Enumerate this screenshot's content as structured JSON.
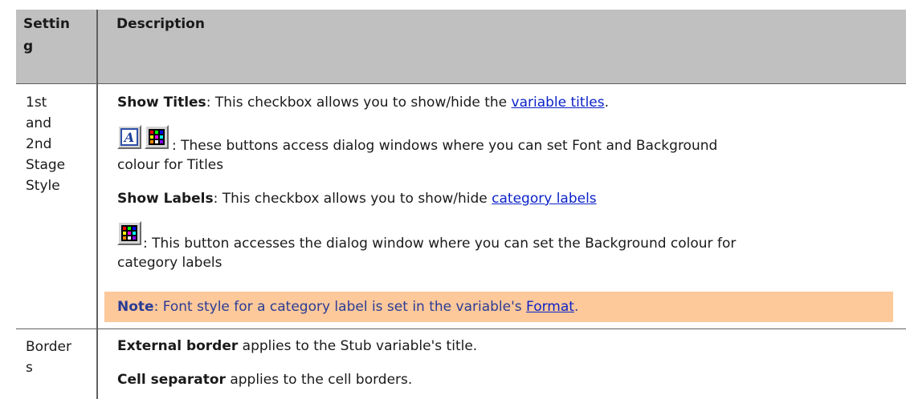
{
  "header": {
    "setting_line1": "Settin",
    "setting_line2": "g",
    "description": "Description"
  },
  "row1": {
    "setting_lines": [
      "1st",
      "and",
      "2nd",
      "Stage",
      "Style"
    ],
    "show_titles_bold": "Show Titles",
    "show_titles_text": ": This checkbox allows you to show/hide the ",
    "show_titles_link": "variable titles",
    "show_titles_end": ".",
    "buttons_text_line1": ": These buttons access dialog windows where you can set Font and Background",
    "buttons_text_line2": "colour for Titles",
    "show_labels_bold": "Show Labels",
    "show_labels_text": ": This checkbox allows you to show/hide ",
    "show_labels_link": "category labels",
    "button_text_line1": ": This button accesses the dialog window where you can set the Background colour for",
    "button_text_line2": "category labels",
    "note_bold": "Note",
    "note_text": ": Font style for a category label is set in the variable's ",
    "note_link": "Format",
    "note_end": "."
  },
  "row2": {
    "setting_lines": [
      "Border",
      "s"
    ],
    "external_bold": "External border",
    "external_text": " applies to the Stub variable's title.",
    "cell_sep_bold": "Cell separator",
    "cell_sep_text": " applies to the cell borders."
  },
  "icons": {
    "font_button": "font-icon",
    "color_button": "color-palette-icon"
  },
  "colors": {
    "header_bg": "#c0c0c0",
    "note_bg": "#fdc89a",
    "note_text": "#2a3c96",
    "link": "#0b22c8"
  }
}
